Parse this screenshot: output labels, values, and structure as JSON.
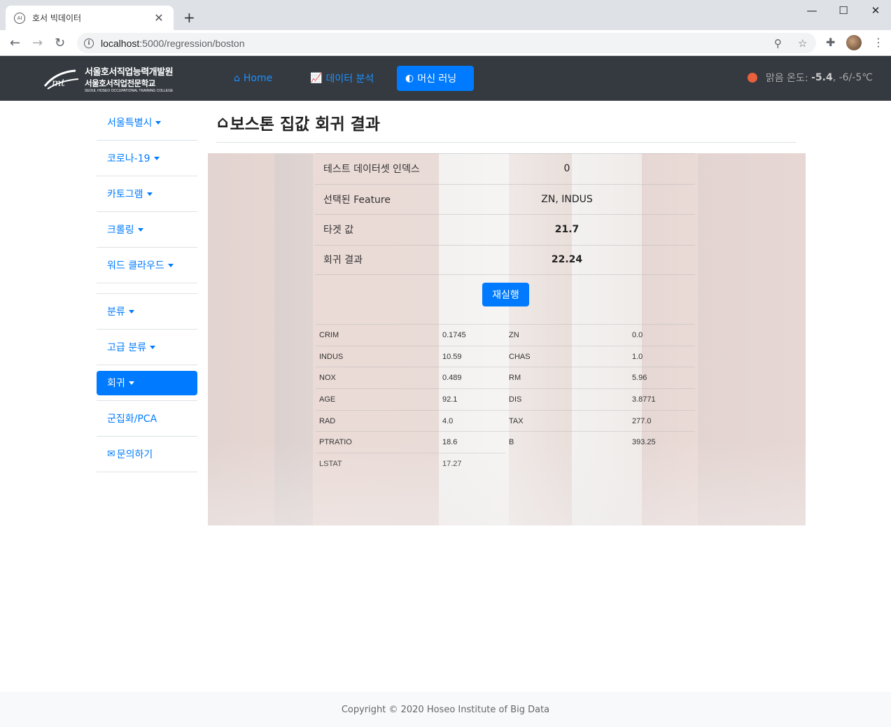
{
  "browser": {
    "tab_title": "호서 빅데이터",
    "tab_favicon": "AI",
    "url_host": "localhost",
    "url_path": ":5000/regression/boston",
    "icons": [
      "back-icon",
      "forward-icon",
      "reload-icon",
      "info-icon",
      "zoom-icon",
      "star-icon",
      "extensions-icon",
      "menu-icon"
    ]
  },
  "navbar": {
    "logo": {
      "line1": "서울호서직업능력개발원",
      "line2": "서울호서직업전문학교",
      "line3": "SEOUL HOSEO OCCUPATIONAL TRAINING COLLEGE"
    },
    "links": [
      {
        "label": "Home",
        "icon": "home-icon",
        "active": false
      },
      {
        "label": "데이터 분석",
        "icon": "chart-icon",
        "active": false
      },
      {
        "label": "머신 러닝",
        "icon": "brain-icon",
        "active": true
      }
    ],
    "weather": {
      "label": "맑음 온도:",
      "temp": "-5.4",
      "range": ", -6/-5℃",
      "dot_color": "#e8613c"
    }
  },
  "sidebar": {
    "items": [
      {
        "label": "서울특별시",
        "dropdown": true
      },
      {
        "label": "코로나-19",
        "dropdown": true
      },
      {
        "label": "카토그램",
        "dropdown": true
      },
      {
        "label": "크롤링",
        "dropdown": true
      },
      {
        "label": "워드 클라우드",
        "dropdown": true
      },
      {
        "label": "분류",
        "dropdown": true
      },
      {
        "label": "고급 분류",
        "dropdown": true
      },
      {
        "label": "회귀",
        "dropdown": true,
        "active": true
      },
      {
        "label": "군집화/PCA",
        "dropdown": false
      },
      {
        "label": "문의하기",
        "dropdown": false,
        "icon": "mail-icon"
      }
    ]
  },
  "main": {
    "title": "보스톤 집값 회귀 결과",
    "results": [
      {
        "key": "테스트 데이터셋 인덱스",
        "value": "0",
        "bold": false
      },
      {
        "key": "선택된 Feature",
        "value": "ZN, INDUS",
        "bold": false
      },
      {
        "key": "타겟 값",
        "value": "21.7",
        "bold": true
      },
      {
        "key": "회귀 결과",
        "value": "22.24",
        "bold": true
      }
    ],
    "rerun_label": "재실행",
    "features": [
      [
        {
          "k": "CRIM",
          "v": "0.1745"
        },
        {
          "k": "ZN",
          "v": "0.0"
        }
      ],
      [
        {
          "k": "INDUS",
          "v": "10.59"
        },
        {
          "k": "CHAS",
          "v": "1.0"
        }
      ],
      [
        {
          "k": "NOX",
          "v": "0.489"
        },
        {
          "k": "RM",
          "v": "5.96"
        }
      ],
      [
        {
          "k": "AGE",
          "v": "92.1"
        },
        {
          "k": "DIS",
          "v": "3.8771"
        }
      ],
      [
        {
          "k": "RAD",
          "v": "4.0"
        },
        {
          "k": "TAX",
          "v": "277.0"
        }
      ],
      [
        {
          "k": "PTRATIO",
          "v": "18.6"
        },
        {
          "k": "B",
          "v": "393.25"
        }
      ],
      [
        {
          "k": "LSTAT",
          "v": "17.27"
        }
      ]
    ]
  },
  "footer": {
    "text": "Copyright © 2020 Hoseo Institute of Big Data"
  }
}
